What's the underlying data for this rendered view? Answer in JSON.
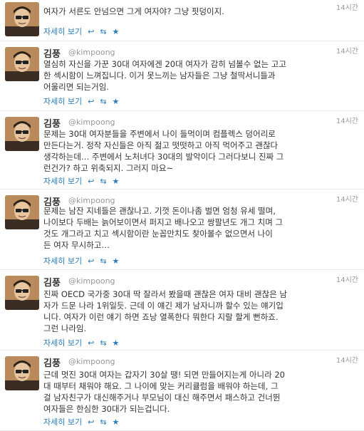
{
  "user": {
    "name": "김풍",
    "handle": "@kimpoong"
  },
  "actions": {
    "detail_label": "자세히 보기",
    "reply_glyph": "↩",
    "retweet_glyph": "⇆",
    "favorite_glyph": "★"
  },
  "tweets": [
    {
      "time": "14시간",
      "lines": [
        "여자가 서른도 안넘으면 그게 여자야? 그냥 핏덩이지."
      ]
    },
    {
      "time": "14시간",
      "lines": [
        "열심히 자신을 가꾼 30대 여자에겐 20대 여자가 감히 넘볼수 없는 고고",
        "한 섹시함이 느껴집니다. 이거 못느끼는 남자들은 그냥 철딱서니들과",
        "어울리면 되는거임."
      ]
    },
    {
      "time": "14시간",
      "lines": [
        "문제는 30대 여자분들을 주변에서 나이 들먹이며 컴플렉스 덩어리로",
        "만든다는거. 정작 자신들은 아직 젊고 떳떳하고 아직 먹어주고 괜찮다",
        "생각하는데… 주변에서 노처녀다 30대의 발악이다 그러다보니 진짜 그",
        "런건가? 하고 위축되지. 그러지 마요~"
      ]
    },
    {
      "time": "14시간",
      "lines": [
        "문제는 남잔 지네들은 괜찮나고. 기껏 돈이나좀 벌면 엄청 유세 떨며,",
        "나이보다 두배는 늙어보이면서 퍼지고 배나오고 쌍팔년도 개그 치며 그",
        "것도 개그라고 치고 섹시함이란 눈꼽만치도 찾아볼수 없으면서 나이",
        "든 여자 무시하고…"
      ]
    },
    {
      "time": "14시간",
      "lines": [
        "진짜 OECD 국가중 30대 딱 잘라서 봤을때 괜찮은 여자 대비 괜찮은 남",
        "자가 드문 나라 1위일듯. 근데 이 얘긴 제가 남자니까 할수 있는 얘기입",
        "니다. 여자가 이런 얘기 하면 죠낭 열폭한다 뭐한다 지랄 할게 뻔하죠.",
        "그런 나라임."
      ]
    },
    {
      "time": "14시간",
      "lines": [
        "근데 멋진 30대 여자는 갑자기 30살 땡! 되면 만들어지는게 아니라 20",
        "대 때부터 채워야 해요. 그 나이에 맞는 커리큘럼을 배워야 하는데, 그",
        "걸 남자친구가 대신해주거나 부모님이 대신 해주면서 패스하고 건너뛴",
        "여자들은 한심한 30대가 되는겁니다."
      ]
    }
  ]
}
